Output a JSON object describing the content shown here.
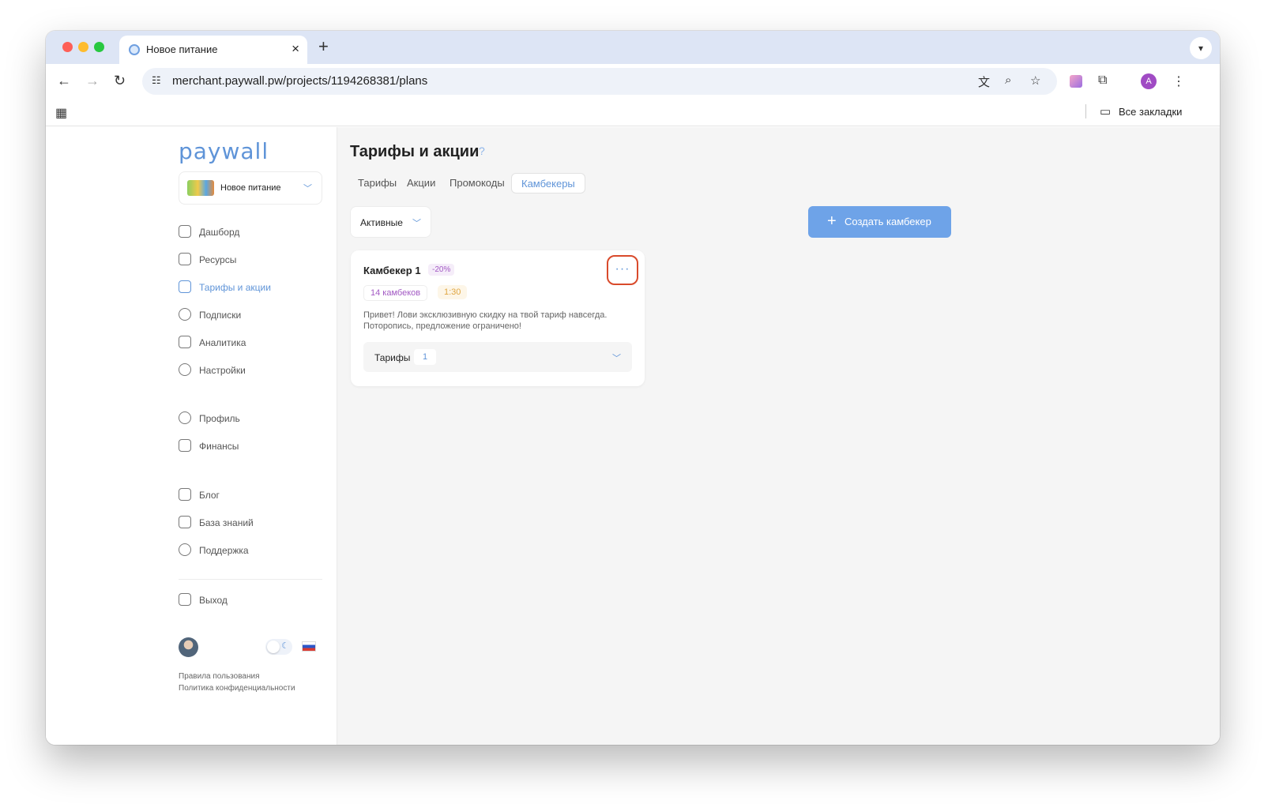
{
  "browser": {
    "tab_title": "Новое питание",
    "url": "merchant.paywall.pw/projects/1194268381/plans",
    "profile_initial": "A",
    "bookmarks_all": "Все закладки"
  },
  "sidebar": {
    "logo": "paywall",
    "project_name": "Новое питание",
    "nav_main": [
      {
        "label": "Дашборд",
        "icon": "dashboard-icon"
      },
      {
        "label": "Ресурсы",
        "icon": "resources-icon"
      },
      {
        "label": "Тарифы и акции",
        "icon": "plans-icon",
        "active": true
      },
      {
        "label": "Подписки",
        "icon": "subscriptions-icon"
      },
      {
        "label": "Аналитика",
        "icon": "analytics-icon"
      },
      {
        "label": "Настройки",
        "icon": "gear-icon"
      }
    ],
    "nav_account": [
      {
        "label": "Профиль",
        "icon": "profile-icon"
      },
      {
        "label": "Финансы",
        "icon": "wallet-icon"
      }
    ],
    "nav_help": [
      {
        "label": "Блог",
        "icon": "blog-icon"
      },
      {
        "label": "База знаний",
        "icon": "knowledge-base-icon"
      },
      {
        "label": "Поддержка",
        "icon": "headset-icon"
      }
    ],
    "logout": "Выход",
    "footer_links": [
      "Правила пользования",
      "Политика конфиденциальности"
    ]
  },
  "main": {
    "title": "Тарифы и акции",
    "help": "?",
    "tabs": [
      {
        "label": "Тарифы"
      },
      {
        "label": "Акции"
      },
      {
        "label": "Промокоды"
      },
      {
        "label": "Камбекеры",
        "active": true
      }
    ],
    "filter": "Активные",
    "create_button": "Создать камбекер",
    "card": {
      "title": "Камбекер 1",
      "discount": "-20%",
      "count": "14 камбеков",
      "time": "1:30",
      "description": "Привет! Лови эксклюзивную скидку на твой тариф навсегда. Поторопись, предложение ограничено!",
      "plans_label": "Тарифы",
      "plans_count": "1"
    }
  },
  "colors": {
    "accent": "#5f94d8",
    "primary_button": "#6ea3e8",
    "highlight": "#d94a2b"
  }
}
